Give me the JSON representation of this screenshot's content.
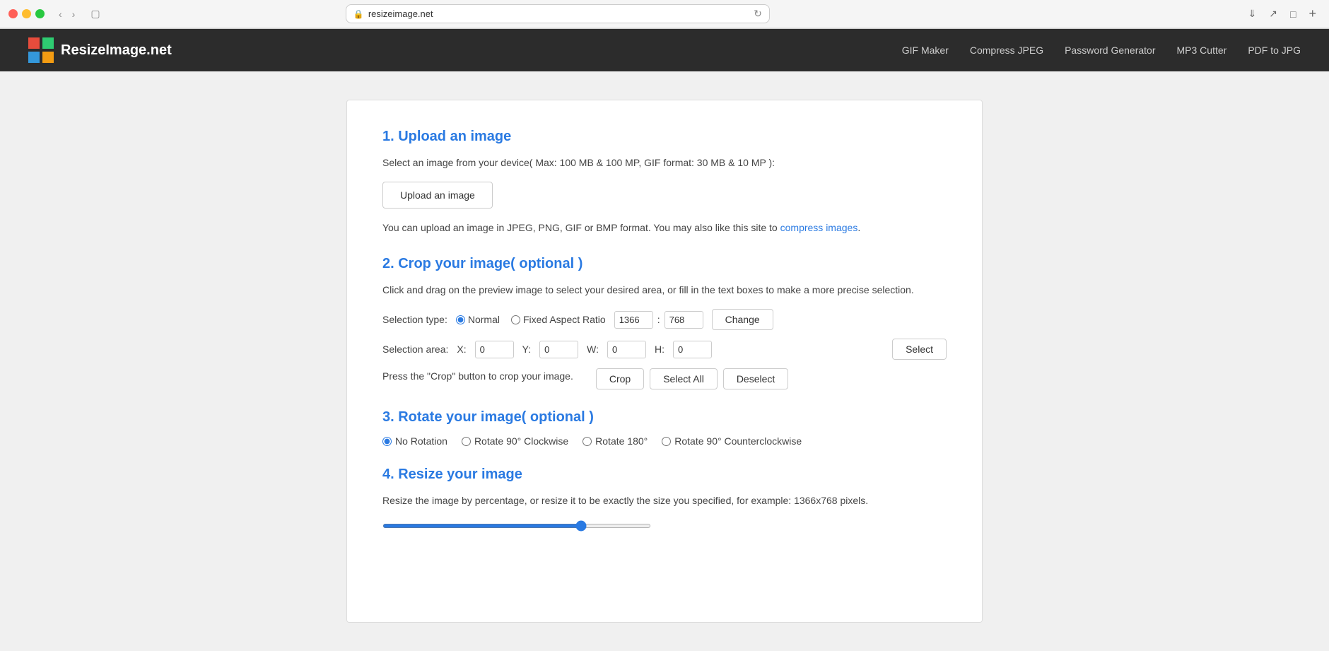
{
  "browser": {
    "url": "resizeimage.net",
    "url_display": "resizeimage.net",
    "new_tab_label": "+"
  },
  "site": {
    "title": "ResizeImage.net",
    "nav_links": [
      {
        "label": "GIF Maker",
        "href": "#"
      },
      {
        "label": "Compress JPEG",
        "href": "#"
      },
      {
        "label": "Password Generator",
        "href": "#"
      },
      {
        "label": "MP3 Cutter",
        "href": "#"
      },
      {
        "label": "PDF to JPG",
        "href": "#"
      }
    ]
  },
  "sections": {
    "upload": {
      "title": "1. Upload an image",
      "desc": "Select an image from your device( Max: 100 MB & 100 MP, GIF format: 30 MB & 10 MP ):",
      "button_label": "Upload an image",
      "note": "You can upload an image in JPEG, PNG, GIF or BMP format. You may also like this site to ",
      "note_link": "compress images",
      "note_end": "."
    },
    "crop": {
      "title": "2. Crop your image( optional )",
      "desc": "Click and drag on the preview image to select your desired area, or fill in the text boxes to make a more precise selection.",
      "selection_type_label": "Selection type:",
      "radio_normal": "Normal",
      "radio_fixed": "Fixed Aspect Ratio",
      "width_val": "1366",
      "height_val": "768",
      "change_btn": "Change",
      "area_label": "Selection area:",
      "x_label": "X:",
      "x_val": "0",
      "y_label": "Y:",
      "y_val": "0",
      "w_label": "W:",
      "w_val": "0",
      "h_label": "H:",
      "h_val": "0",
      "select_btn": "Select",
      "crop_note": "Press the \"Crop\" button to crop your image.",
      "crop_btn": "Crop",
      "select_all_btn": "Select All",
      "deselect_btn": "Deselect"
    },
    "rotate": {
      "title": "3. Rotate your image( optional )",
      "options": [
        {
          "label": "No Rotation",
          "checked": true
        },
        {
          "label": "Rotate 90° Clockwise",
          "checked": false
        },
        {
          "label": "Rotate 180°",
          "checked": false
        },
        {
          "label": "Rotate 90° Counterclockwise",
          "checked": false
        }
      ]
    },
    "resize": {
      "title": "4. Resize your image",
      "desc": "Resize the image by percentage, or resize it to be exactly the size you specified, for example: 1366x768 pixels.",
      "slider_value": 75
    }
  }
}
